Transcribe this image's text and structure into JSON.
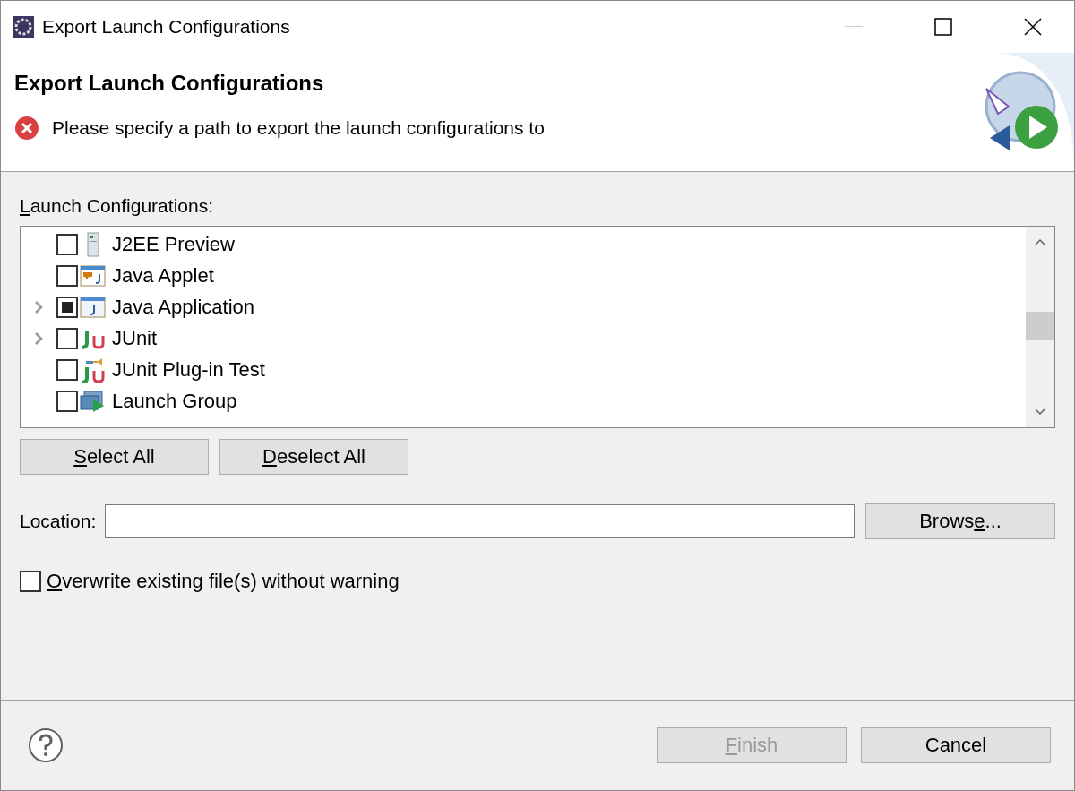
{
  "window": {
    "title": "Export Launch Configurations"
  },
  "header": {
    "title": "Export Launch Configurations",
    "message": "Please specify a path to export the launch configurations to"
  },
  "tree": {
    "label": {
      "key": "L",
      "after": "aunch Configurations:"
    },
    "items": [
      {
        "label": "J2EE Preview",
        "kind": "server",
        "checked": false,
        "mixed": false,
        "expandable": false
      },
      {
        "label": "Java Applet",
        "kind": "applet",
        "checked": false,
        "mixed": false,
        "expandable": false
      },
      {
        "label": "Java Application",
        "kind": "app",
        "checked": false,
        "mixed": true,
        "expandable": true
      },
      {
        "label": "JUnit",
        "kind": "junit",
        "checked": false,
        "mixed": false,
        "expandable": true
      },
      {
        "label": "JUnit Plug-in Test",
        "kind": "plugin",
        "checked": false,
        "mixed": false,
        "expandable": false
      },
      {
        "label": "Launch Group",
        "kind": "group",
        "checked": false,
        "mixed": false,
        "expandable": false
      }
    ]
  },
  "selection_buttons": [
    {
      "label": {
        "key": "S",
        "after": "elect All"
      }
    },
    {
      "label": {
        "key": "D",
        "after": "eselect All"
      }
    }
  ],
  "location": {
    "label": "Location:",
    "browse": {
      "before": "Brows",
      "key": "e",
      "after": "..."
    }
  },
  "overwrite": {
    "label": {
      "key": "O",
      "after": "verwrite existing file(s) without warning"
    },
    "checked": false
  },
  "footer": {
    "buttons": [
      {
        "label": {
          "key": "F",
          "after": "inish"
        },
        "disabled": true
      },
      {
        "label": {
          "before": "Cancel"
        },
        "disabled": false
      }
    ]
  }
}
